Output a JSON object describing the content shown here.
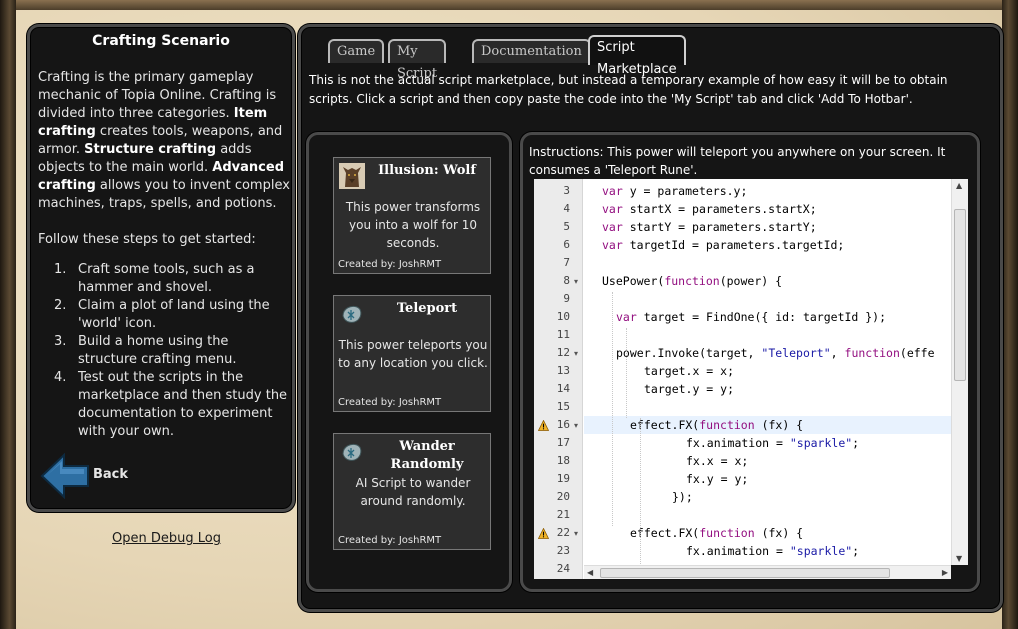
{
  "sidebar": {
    "title": "Crafting Scenario",
    "intro_1": "Crafting is the primary gameplay mechanic of Topia Online. Crafting is divided into three categories.",
    "item_label": "Item crafting",
    "item_text": "creates tools, weapons, and armor.",
    "structure_label": "Structure crafting",
    "structure_text": "adds objects to the main world.",
    "advanced_label": "Advanced crafting",
    "advanced_text": "allows you to invent complex machines, traps, spells, and potions.",
    "steps_intro": "Follow these steps to get started:",
    "steps": [
      {
        "num": "1.",
        "text": "Craft some tools, such as a hammer and shovel."
      },
      {
        "num": "2.",
        "text": "Claim a plot of land using the 'world' icon."
      },
      {
        "num": "3.",
        "text": "Build a home using the structure crafting menu."
      },
      {
        "num": "4.",
        "text": "Test out the scripts in the marketplace and then study the documentation to experiment with your own."
      }
    ],
    "back_label": "Back",
    "back_icon": "left-arrow-icon",
    "accent_color": "#2e6fa3"
  },
  "debug_link": "Open Debug Log",
  "tabs": [
    {
      "label": "Game",
      "active": false
    },
    {
      "label": "My Script",
      "active": false
    },
    {
      "label": "Documentation",
      "active": false
    },
    {
      "label": "Script Marketplace",
      "active": true
    }
  ],
  "intro": "This is not the actual script marketplace, but instead a temporary example of how easy it will be to obtain scripts. Click a script and then copy paste the code into the 'My Script' tab and click 'Add To Hotbar'.",
  "scripts": [
    {
      "title": "Illusion: Wolf",
      "description": "This power transforms you into a wolf for 10 seconds.",
      "author": "Created by: JoshRMT",
      "icon": "wolf-icon"
    },
    {
      "title": "Teleport",
      "description": "This power teleports you to any location you click.",
      "author": "Created by: JoshRMT",
      "icon": "rune-icon"
    },
    {
      "title": "Wander Randomly",
      "description": "AI Script to wander around randomly.",
      "author": "Created by: JoshRMT",
      "icon": "rune-icon"
    }
  ],
  "instructions": "Instructions: This power will teleport you anywhere on your screen. It consumes a 'Teleport Rune'.",
  "editor": {
    "lines": [
      {
        "n": "3",
        "code": "var y = parameters.y;"
      },
      {
        "n": "4",
        "code": "var startX = parameters.startX;"
      },
      {
        "n": "5",
        "code": "var startY = parameters.startY;"
      },
      {
        "n": "6",
        "code": "var targetId = parameters.targetId;"
      },
      {
        "n": "7",
        "code": ""
      },
      {
        "n": "8",
        "code": "UsePower(function(power) {"
      },
      {
        "n": "9",
        "code": ""
      },
      {
        "n": "10",
        "code": "var target = FindOne({ id: targetId });"
      },
      {
        "n": "11",
        "code": ""
      },
      {
        "n": "12",
        "code": "power.Invoke(target, \"Teleport\", function(effe"
      },
      {
        "n": "13",
        "code": "target.x = x;"
      },
      {
        "n": "14",
        "code": "target.y = y;"
      },
      {
        "n": "15",
        "code": ""
      },
      {
        "n": "16",
        "code": "effect.FX(function (fx) {"
      },
      {
        "n": "17",
        "code": "fx.animation = \"sparkle\";"
      },
      {
        "n": "18",
        "code": "fx.x = x;"
      },
      {
        "n": "19",
        "code": "fx.y = y;"
      },
      {
        "n": "20",
        "code": "});"
      },
      {
        "n": "21",
        "code": ""
      },
      {
        "n": "22",
        "code": "effect.FX(function (fx) {"
      },
      {
        "n": "23",
        "code": "fx.animation = \"sparkle\";"
      },
      {
        "n": "24",
        "code": ""
      }
    ],
    "warning_lines": [
      "16",
      "22"
    ],
    "fold_lines": [
      "8",
      "12",
      "16",
      "22"
    ],
    "active_line": "16"
  }
}
